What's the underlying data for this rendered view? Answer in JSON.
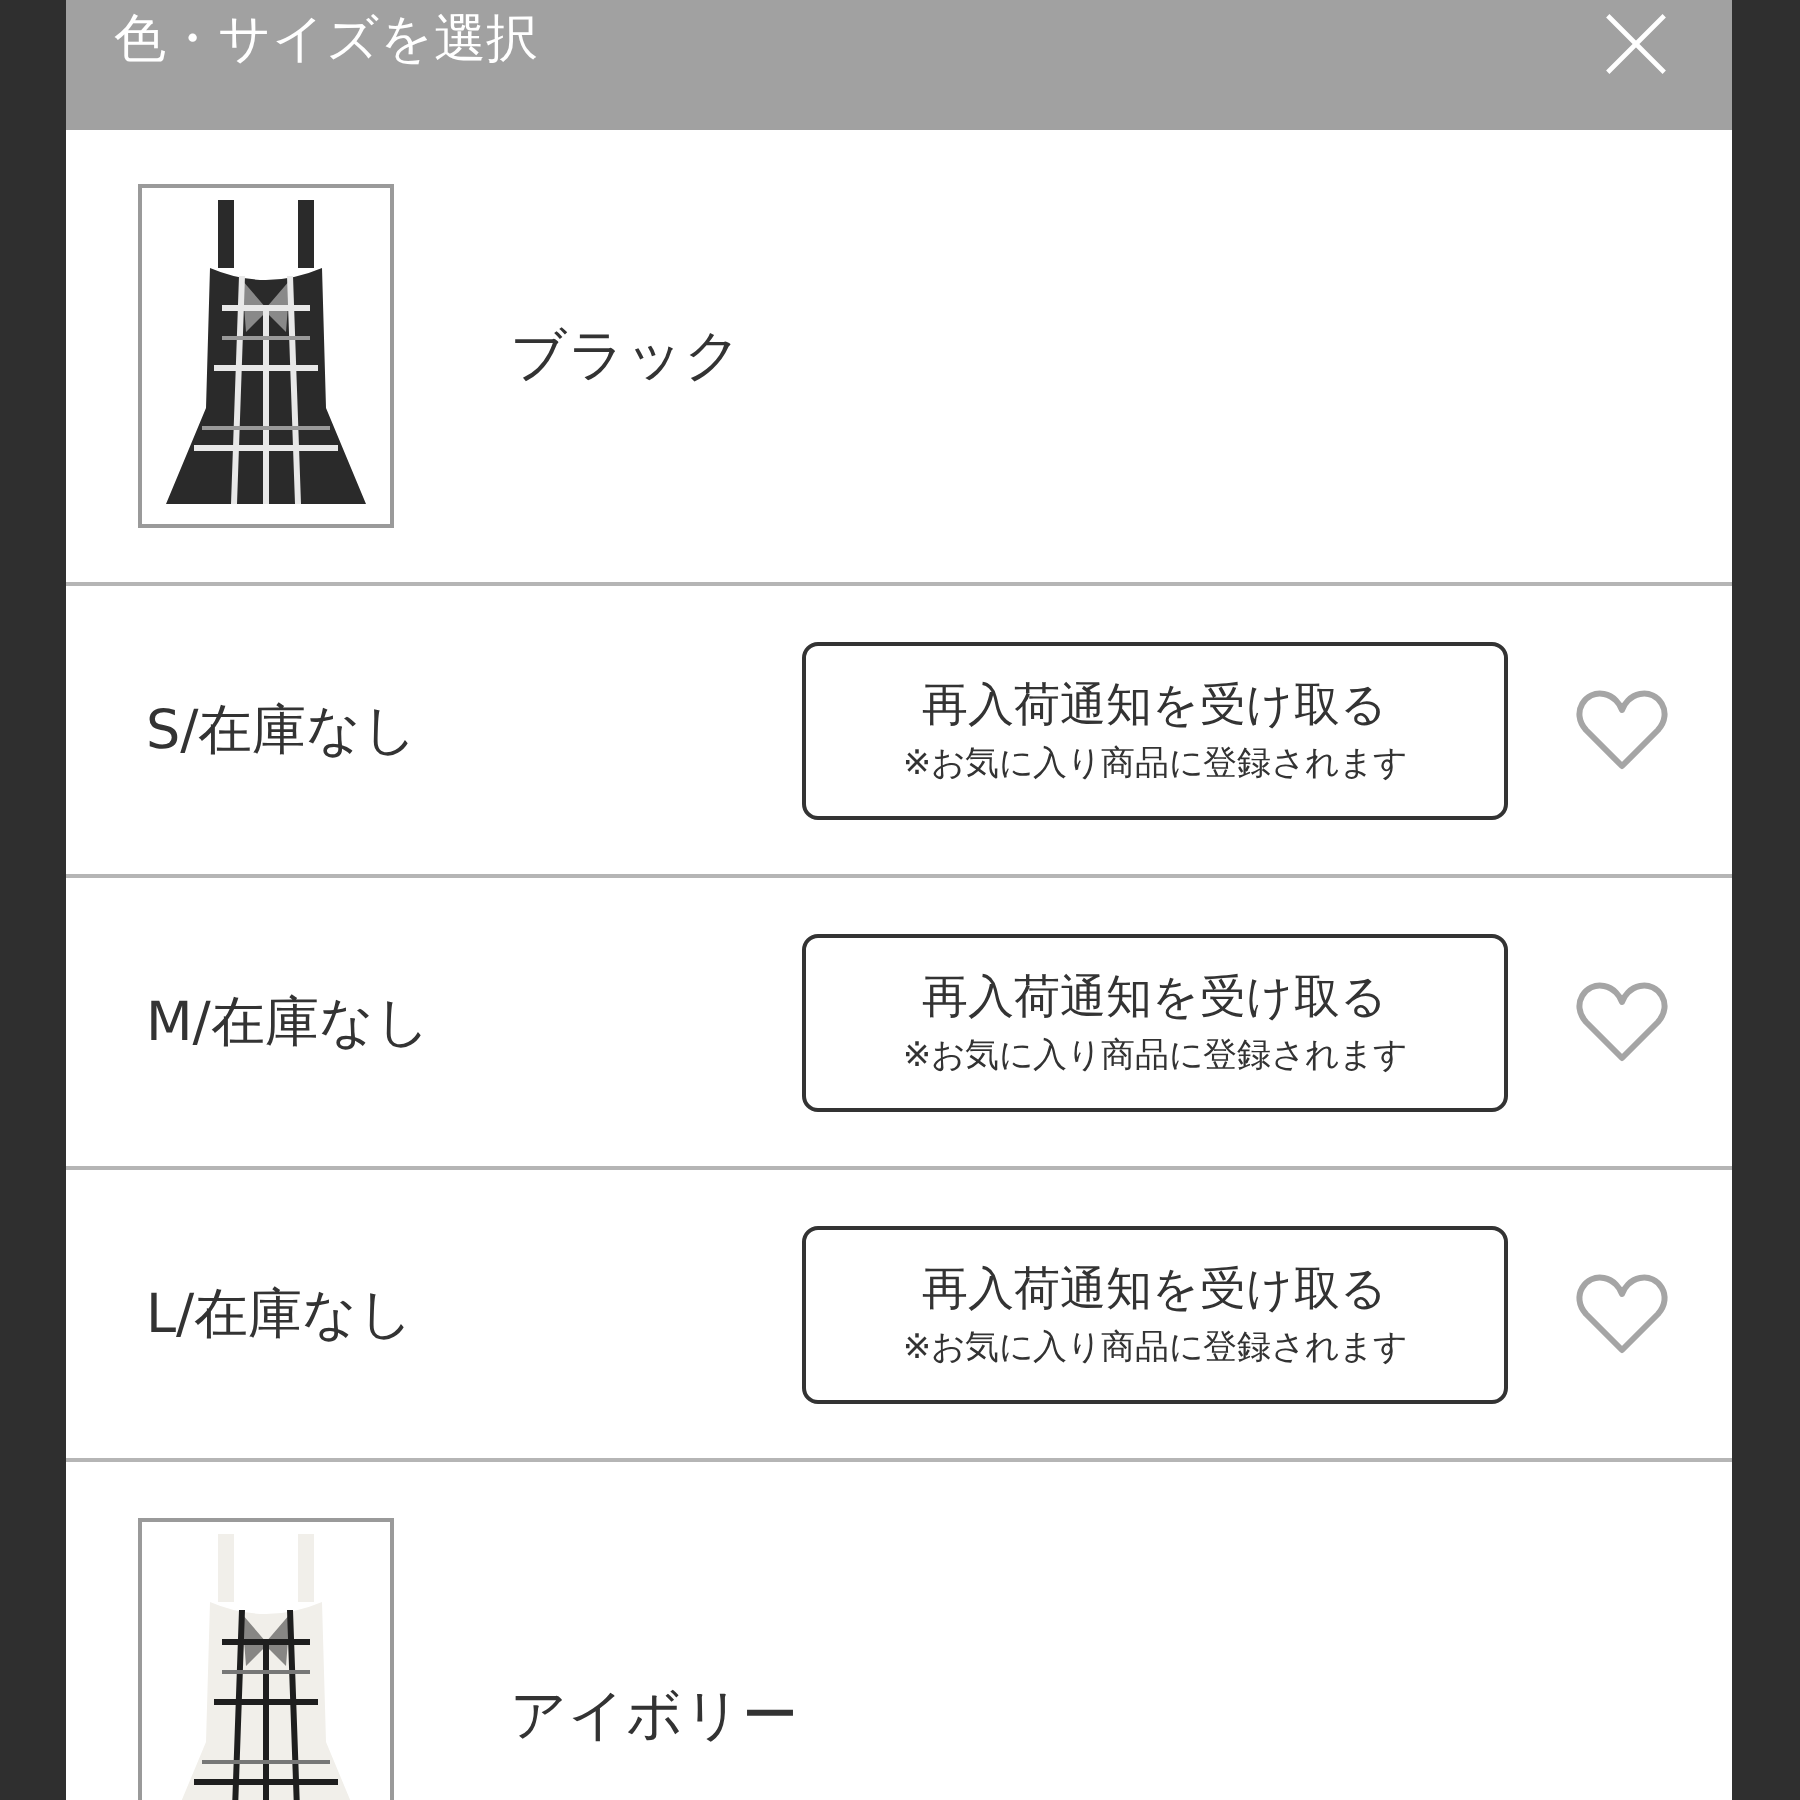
{
  "dialog": {
    "title": "色・サイズを選択"
  },
  "options": [
    {
      "kind": "color",
      "name": "ブラック"
    },
    {
      "kind": "size",
      "label": "S/在庫なし",
      "button": {
        "title": "再入荷通知を受け取る",
        "note": "※お気に入り商品に登録されます"
      }
    },
    {
      "kind": "size",
      "label": "M/在庫なし",
      "button": {
        "title": "再入荷通知を受け取る",
        "note": "※お気に入り商品に登録されます"
      }
    },
    {
      "kind": "size",
      "label": "L/在庫なし",
      "button": {
        "title": "再入荷通知を受け取る",
        "note": "※お気に入り商品に登録されます"
      }
    },
    {
      "kind": "color",
      "name": "アイボリー"
    }
  ]
}
